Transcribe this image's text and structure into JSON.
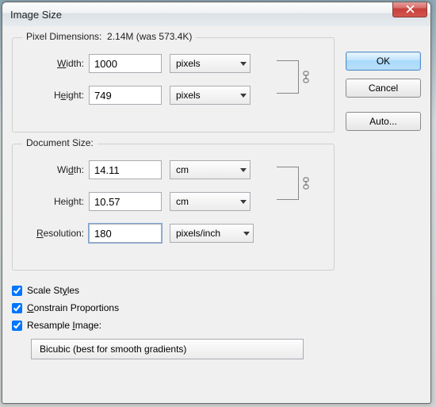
{
  "window": {
    "title": "Image Size"
  },
  "buttons": {
    "ok": "OK",
    "cancel": "Cancel",
    "auto": "Auto..."
  },
  "pixel": {
    "legend": "Pixel Dimensions:",
    "info": "2.14M (was 573.4K)",
    "width_label": "Width:",
    "width_value": "1000",
    "height_label": "Height:",
    "height_value": "749",
    "unit": "pixels"
  },
  "doc": {
    "legend": "Document Size:",
    "width_label": "Width:",
    "width_value": "14.11",
    "height_label": "Height:",
    "height_value": "10.57",
    "resolution_label": "Resolution:",
    "resolution_value": "180",
    "unit": "cm",
    "res_unit": "pixels/inch"
  },
  "checks": {
    "scale_styles": "Scale Styles",
    "constrain": "Constrain Proportions",
    "resample": "Resample Image:"
  },
  "resample_method": "Bicubic (best for smooth gradients)"
}
